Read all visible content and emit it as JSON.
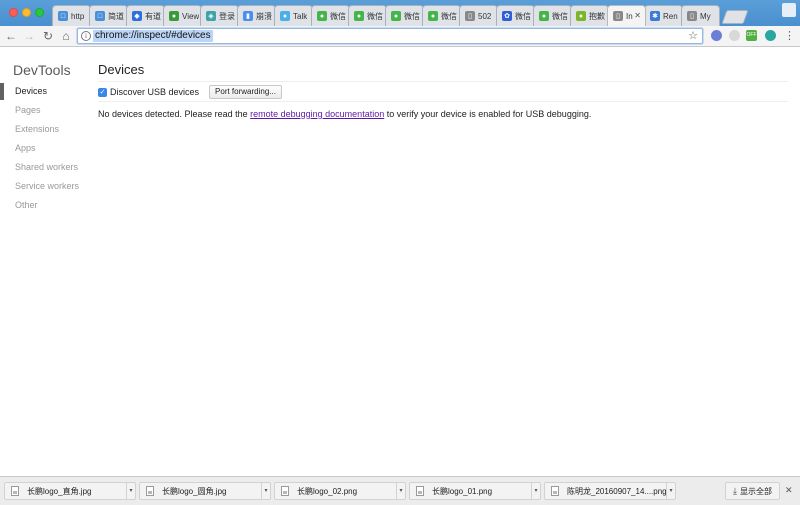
{
  "tabs": [
    {
      "label": "http",
      "icon": "chat-doc-icon",
      "color": "#4a90d9",
      "glyph": "□"
    },
    {
      "label": "简道",
      "icon": "chat-doc-icon",
      "color": "#4a90d9",
      "glyph": "□"
    },
    {
      "label": "有道",
      "icon": "compass-icon",
      "color": "#2f6fdc",
      "glyph": "◆"
    },
    {
      "label": "View",
      "icon": "frog-icon",
      "color": "#3a9a3a",
      "glyph": "●"
    },
    {
      "label": "登录",
      "icon": "tag-icon",
      "color": "#3ba4a8",
      "glyph": "◈"
    },
    {
      "label": "崩溃",
      "icon": "bookmark-icon",
      "color": "#4a8ff0",
      "glyph": "▮"
    },
    {
      "label": "Talk",
      "icon": "globe-icon",
      "color": "#48b0e8",
      "glyph": "●"
    },
    {
      "label": "微信",
      "icon": "wechat-icon",
      "color": "#44b549",
      "glyph": "●"
    },
    {
      "label": "微信",
      "icon": "wechat-icon",
      "color": "#44b549",
      "glyph": "●"
    },
    {
      "label": "微信",
      "icon": "wechat-icon",
      "color": "#44b549",
      "glyph": "●"
    },
    {
      "label": "微信",
      "icon": "wechat-icon",
      "color": "#44b549",
      "glyph": "●"
    },
    {
      "label": "502",
      "icon": "page-icon",
      "color": "#888888",
      "glyph": "▯"
    },
    {
      "label": "微信",
      "icon": "paw-icon",
      "color": "#2e5fd8",
      "glyph": "✿"
    },
    {
      "label": "微信",
      "icon": "wechat-icon",
      "color": "#44b549",
      "glyph": "●"
    },
    {
      "label": "抱歉",
      "icon": "wechat-icon",
      "color": "#7bb52a",
      "glyph": "●"
    },
    {
      "label": "In",
      "icon": "page-icon",
      "color": "#888888",
      "glyph": "▯",
      "active": true
    },
    {
      "label": "Ren",
      "icon": "gear-icon",
      "color": "#3b79d8",
      "glyph": "✱"
    },
    {
      "label": "My",
      "icon": "page-icon",
      "color": "#888888",
      "glyph": "▯"
    }
  ],
  "toolbar": {
    "url": "chrome://inspect/#devices",
    "info_glyph": "i",
    "star_glyph": "☆",
    "back_glyph": "←",
    "forward_glyph": "→",
    "reload_glyph": "↻",
    "home_glyph": "⌂",
    "menu_glyph": "⋮",
    "ext_badge": "OFF"
  },
  "sidebar": {
    "brand": "DevTools",
    "items": [
      {
        "label": "Devices",
        "active": true
      },
      {
        "label": "Pages"
      },
      {
        "label": "Extensions"
      },
      {
        "label": "Apps"
      },
      {
        "label": "Shared workers"
      },
      {
        "label": "Service workers"
      },
      {
        "label": "Other"
      }
    ]
  },
  "main": {
    "title": "Devices",
    "discover_label": "Discover USB devices",
    "discover_checked": true,
    "port_forwarding_label": "Port forwarding...",
    "message_before": "No devices detected. Please read the ",
    "message_link": "remote debugging documentation",
    "message_after": " to verify your device is enabled for USB debugging."
  },
  "downloads": {
    "items": [
      {
        "name": "长鹏logo_直角.jpg"
      },
      {
        "name": "长鹏logo_圆角.jpg"
      },
      {
        "name": "长鹏logo_02.png"
      },
      {
        "name": "长鹏logo_01.png"
      },
      {
        "name": "陈明龙_20160907_14....png"
      }
    ],
    "show_all": "显示全部",
    "close_glyph": "✕",
    "caret_glyph": "▾",
    "download_glyph": "⤓"
  },
  "colors": {
    "tabstrip": "#4a8fcf",
    "link": "#5d19a6",
    "checkbox": "#3b87e8"
  }
}
